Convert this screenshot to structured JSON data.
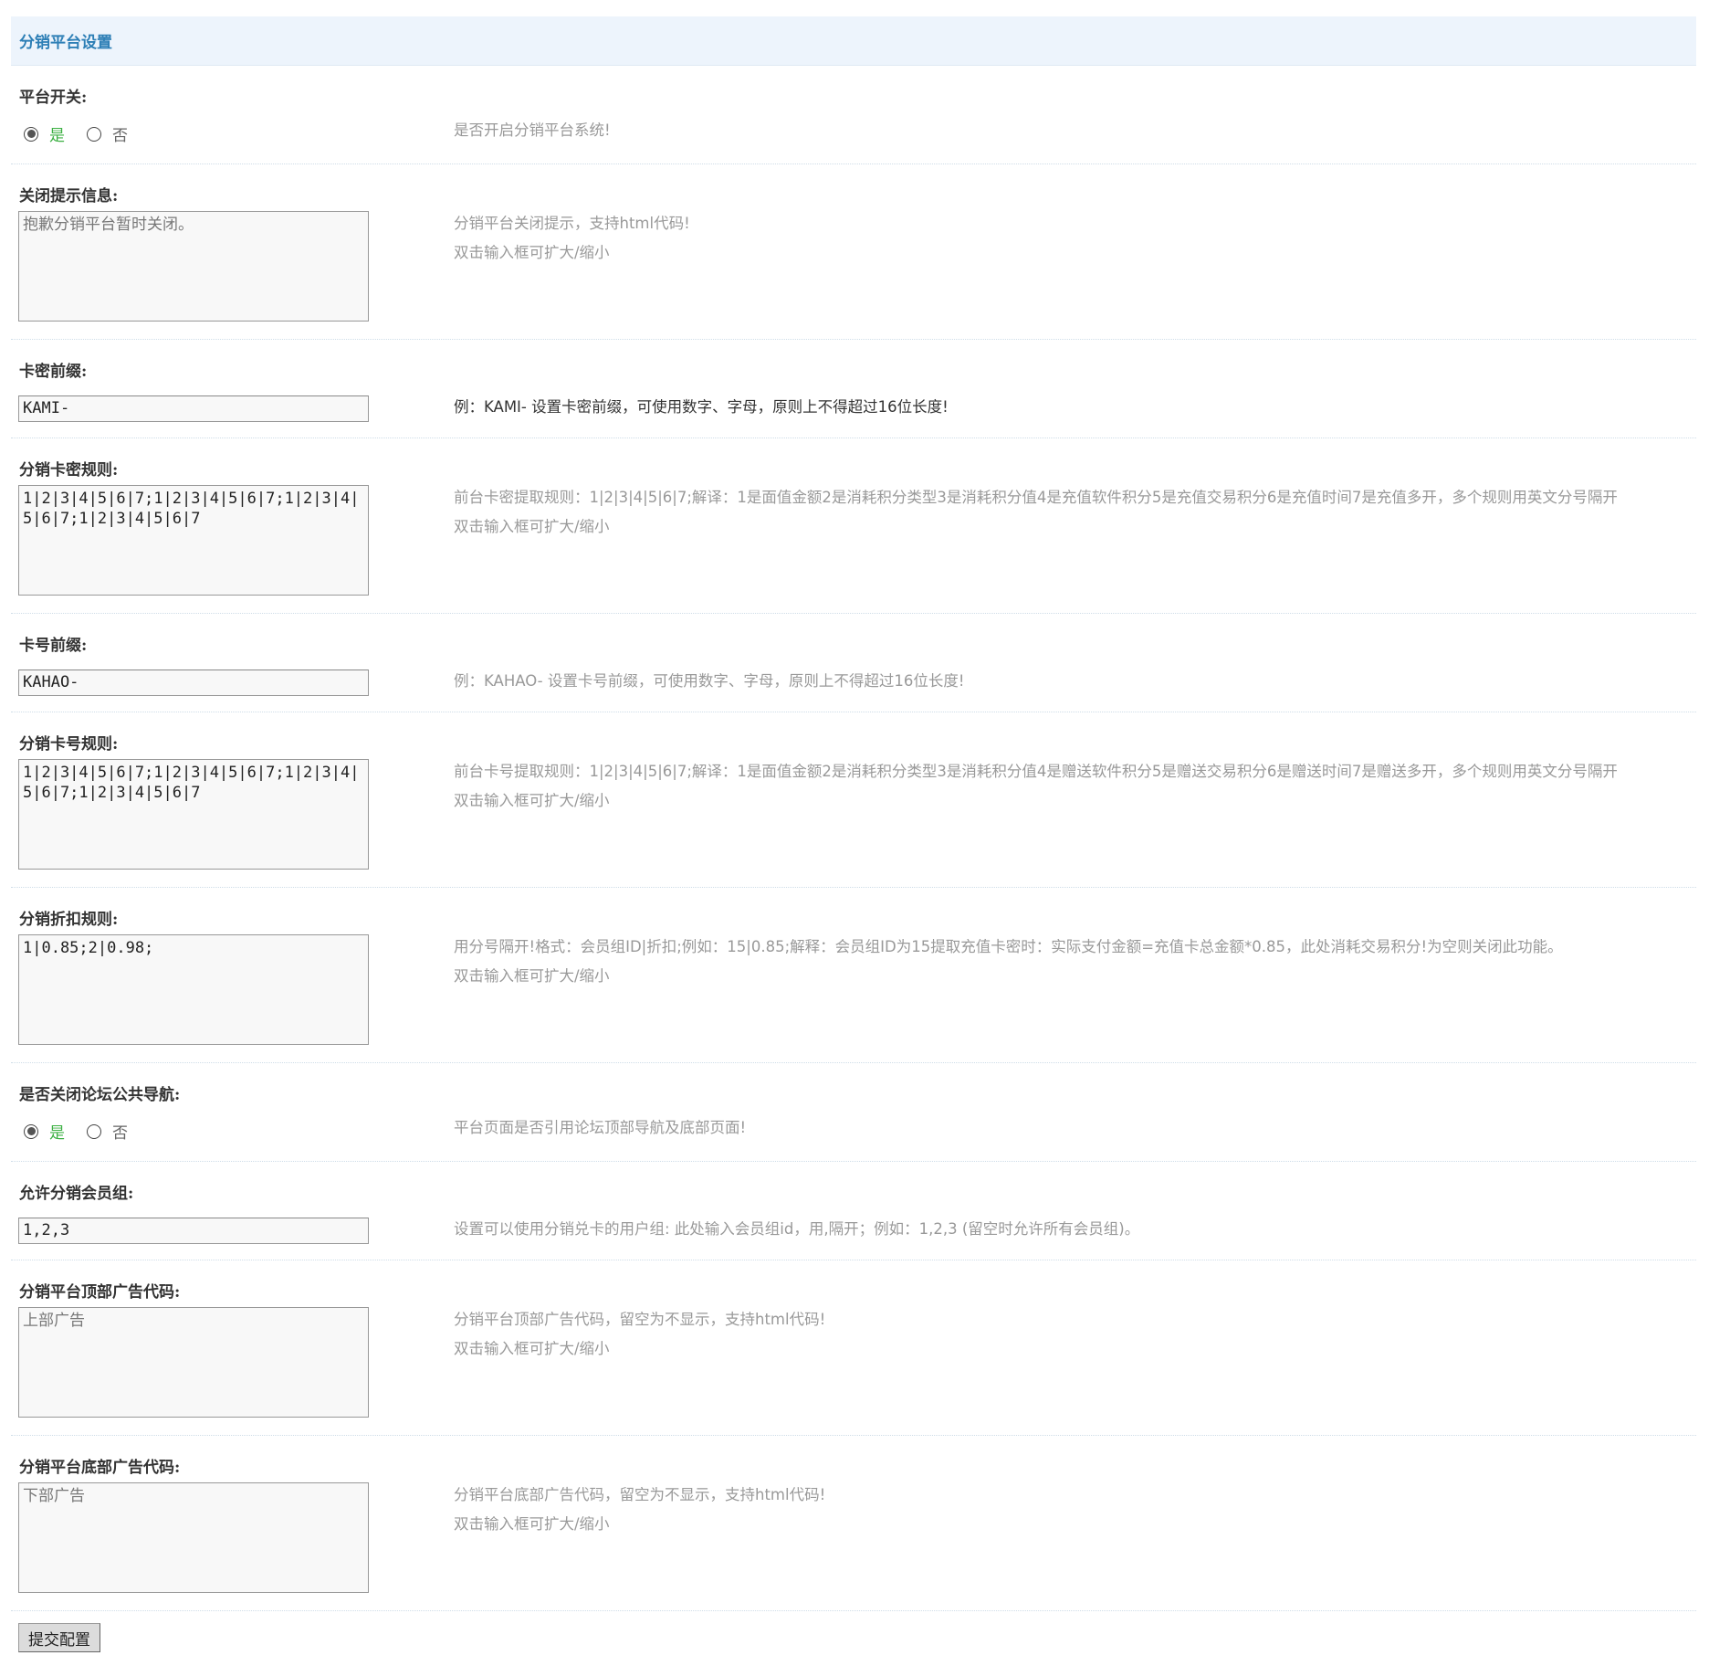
{
  "header": {
    "title": "分销平台设置"
  },
  "radio_labels": {
    "yes": "是",
    "no": "否"
  },
  "settings": {
    "platform_switch": {
      "label": "平台开关:",
      "desc": "是否开启分销平台系统!"
    },
    "close_message": {
      "label": "关闭提示信息:",
      "value": "抱歉分销平台暂时关闭。",
      "desc1": "分销平台关闭提示，支持html代码!",
      "desc2": "双击输入框可扩大/缩小"
    },
    "card_secret_prefix": {
      "label": "卡密前缀:",
      "value": "KAMI-",
      "desc_prefix": "例：",
      "desc_value": "KAMI-",
      "desc_mid": " 设置卡密前缀，可使用数字、字母，原则上不得超过",
      "desc_num": "16",
      "desc_end": "位长度!"
    },
    "card_secret_rule": {
      "label": "分销卡密规则:",
      "value": "1|2|3|4|5|6|7;1|2|3|4|5|6|7;1|2|3|4|5|6|7;1|2|3|4|5|6|7",
      "desc1": "前台卡密提取规则：1|2|3|4|5|6|7;解译：1是面值金额2是消耗积分类型3是消耗积分值4是充值软件积分5是充值交易积分6是充值时间7是充值多开，多个规则用英文分号隔开",
      "desc2": "双击输入框可扩大/缩小"
    },
    "card_number_prefix": {
      "label": "卡号前缀:",
      "value": "KAHAO-",
      "desc": "例：KAHAO- 设置卡号前缀，可使用数字、字母，原则上不得超过16位长度!"
    },
    "card_number_rule": {
      "label": "分销卡号规则:",
      "value": "1|2|3|4|5|6|7;1|2|3|4|5|6|7;1|2|3|4|5|6|7;1|2|3|4|5|6|7",
      "desc1": "前台卡号提取规则：1|2|3|4|5|6|7;解译：1是面值金额2是消耗积分类型3是消耗积分值4是赠送软件积分5是赠送交易积分6是赠送时间7是赠送多开，多个规则用英文分号隔开",
      "desc2": "双击输入框可扩大/缩小"
    },
    "discount_rule": {
      "label": "分销折扣规则:",
      "value": "1|0.85;2|0.98;",
      "desc1": "用分号隔开!格式：会员组ID|折扣;例如：15|0.85;解释：会员组ID为15提取充值卡密时：实际支付金额=充值卡总金额*0.85，此处消耗交易积分!为空则关闭此功能。",
      "desc2": "双击输入框可扩大/缩小"
    },
    "close_forum_nav": {
      "label": "是否关闭论坛公共导航:",
      "desc": "平台页面是否引用论坛顶部导航及底部页面!"
    },
    "allowed_groups": {
      "label": "允许分销会员组:",
      "value": "1,2,3",
      "desc": "设置可以使用分销兑卡的用户组: 此处输入会员组id，用,隔开；例如：1,2,3 (留空时允许所有会员组)。"
    },
    "top_ad": {
      "label": "分销平台顶部广告代码:",
      "value": "上部广告",
      "desc1": "分销平台顶部广告代码，留空为不显示，支持html代码!",
      "desc2": "双击输入框可扩大/缩小"
    },
    "bottom_ad": {
      "label": "分销平台底部广告代码:",
      "value": "下部广告",
      "desc1": "分销平台底部广告代码，留空为不显示，支持html代码!",
      "desc2": "双击输入框可扩大/缩小"
    }
  },
  "submit": {
    "label": "提交配置"
  }
}
